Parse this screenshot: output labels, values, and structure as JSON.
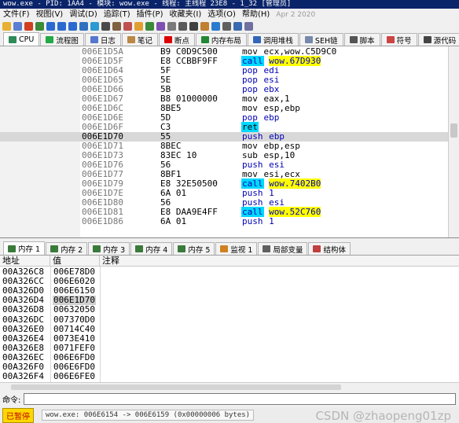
{
  "title": "wow.exe - PID: 1AA4 - 模块: wow.exe - 线程: 主线程 23E8 - 1_32 [管理员]",
  "menu": [
    "文件(F)",
    "视图(V)",
    "调试(D)",
    "追踪(T)",
    "插件(P)",
    "收藏夹(I)",
    "选项(O)",
    "帮助(H)"
  ],
  "menu_date": "Apr 2 2020",
  "tabs": [
    {
      "label": "CPU",
      "icon": "cpu-icon",
      "color": "#2e8b57"
    },
    {
      "label": "流程图",
      "icon": "graph-icon",
      "color": "#22aa44"
    },
    {
      "label": "日志",
      "icon": "log-icon",
      "color": "#5577cc"
    },
    {
      "label": "笔记",
      "icon": "notes-icon",
      "color": "#bb8844"
    },
    {
      "label": "断点",
      "icon": "breakpoint-icon",
      "color": "#dd0000"
    },
    {
      "label": "内存布局",
      "icon": "memory-map-icon",
      "color": "#228833"
    },
    {
      "label": "调用堆栈",
      "icon": "call-stack-icon",
      "color": "#3366bb"
    },
    {
      "label": "SEH链",
      "icon": "seh-icon",
      "color": "#7788aa"
    },
    {
      "label": "脚本",
      "icon": "script-icon",
      "color": "#555555"
    },
    {
      "label": "符号",
      "icon": "symbols-icon",
      "color": "#cc4444"
    },
    {
      "label": "源代码",
      "icon": "source-icon",
      "color": "#444444"
    }
  ],
  "disasm": [
    {
      "addr": "006E1D5A",
      "bytes": "B9 C0D9C500",
      "mn": "mov",
      "mnc": "plain",
      "op": "ecx,wow.C5D9C0",
      "opc": ""
    },
    {
      "addr": "006E1D5F",
      "bytes": "E8 CCBBF9FF",
      "mn": "call",
      "mnc": "call",
      "op": "wow.67D930",
      "opc": "tgt"
    },
    {
      "addr": "006E1D64",
      "bytes": "5F",
      "mn": "pop",
      "mnc": "pop",
      "op": "edi",
      "opc": "num"
    },
    {
      "addr": "006E1D65",
      "bytes": "5E",
      "mn": "pop",
      "mnc": "pop",
      "op": "esi",
      "opc": "num"
    },
    {
      "addr": "006E1D66",
      "bytes": "5B",
      "mn": "pop",
      "mnc": "pop",
      "op": "ebx",
      "opc": "num"
    },
    {
      "addr": "006E1D67",
      "bytes": "B8 01000000",
      "mn": "mov",
      "mnc": "plain",
      "op": "eax,1",
      "opc": ""
    },
    {
      "addr": "006E1D6C",
      "bytes": "8BE5",
      "mn": "mov",
      "mnc": "plain",
      "op": "esp,ebp",
      "opc": ""
    },
    {
      "addr": "006E1D6E",
      "bytes": "5D",
      "mn": "pop",
      "mnc": "pop",
      "op": "ebp",
      "opc": "num"
    },
    {
      "addr": "006E1D6F",
      "bytes": "C3",
      "mn": "ret",
      "mnc": "ret",
      "op": "",
      "opc": ""
    },
    {
      "addr": "006E1D70",
      "bytes": "55",
      "mn": "push",
      "mnc": "push",
      "op": "ebp",
      "opc": "num",
      "sel": true
    },
    {
      "addr": "006E1D71",
      "bytes": "8BEC",
      "mn": "mov",
      "mnc": "plain",
      "op": "ebp,esp",
      "opc": ""
    },
    {
      "addr": "006E1D73",
      "bytes": "83EC 10",
      "mn": "sub",
      "mnc": "plain",
      "op": "esp,10",
      "opc": ""
    },
    {
      "addr": "006E1D76",
      "bytes": "56",
      "mn": "push",
      "mnc": "push",
      "op": "esi",
      "opc": "num"
    },
    {
      "addr": "006E1D77",
      "bytes": "8BF1",
      "mn": "mov",
      "mnc": "plain",
      "op": "esi,ecx",
      "opc": ""
    },
    {
      "addr": "006E1D79",
      "bytes": "E8 32E50500",
      "mn": "call",
      "mnc": "call",
      "op": "wow.7402B0",
      "opc": "tgt"
    },
    {
      "addr": "006E1D7E",
      "bytes": "6A 01",
      "mn": "push",
      "mnc": "push",
      "op": "1",
      "opc": "num"
    },
    {
      "addr": "006E1D80",
      "bytes": "56",
      "mn": "push",
      "mnc": "push",
      "op": "esi",
      "opc": "num"
    },
    {
      "addr": "006E1D81",
      "bytes": "E8 DAA9E4FF",
      "mn": "call",
      "mnc": "call",
      "op": "wow.52C760",
      "opc": "tgt"
    },
    {
      "addr": "006E1D86",
      "bytes": "6A 01",
      "mn": "push",
      "mnc": "push",
      "op": "1",
      "opc": "num"
    }
  ],
  "mem_tabs": [
    {
      "label": "内存 1",
      "icon": "memory-icon"
    },
    {
      "label": "内存 2",
      "icon": "memory-icon"
    },
    {
      "label": "内存 3",
      "icon": "memory-icon"
    },
    {
      "label": "内存 4",
      "icon": "memory-icon"
    },
    {
      "label": "内存 5",
      "icon": "memory-icon"
    },
    {
      "label": "监视 1",
      "icon": "watch-icon"
    },
    {
      "label": "局部变量",
      "icon": "locals-icon"
    },
    {
      "label": "结构体",
      "icon": "struct-icon"
    }
  ],
  "mem_header": {
    "addr": "地址",
    "value": "值",
    "comment": "注释"
  },
  "mem_rows": [
    {
      "a": "00A326C8",
      "v": "006E78D0"
    },
    {
      "a": "00A326CC",
      "v": "006E6020"
    },
    {
      "a": "00A326D0",
      "v": "006E6150"
    },
    {
      "a": "00A326D4",
      "v": "006E1D70",
      "hl": true
    },
    {
      "a": "00A326D8",
      "v": "00632050"
    },
    {
      "a": "00A326DC",
      "v": "007370D0"
    },
    {
      "a": "00A326E0",
      "v": "00714C40"
    },
    {
      "a": "00A326E4",
      "v": "0073E410"
    },
    {
      "a": "00A326E8",
      "v": "0071FEF0"
    },
    {
      "a": "00A326EC",
      "v": "006E6FD0"
    },
    {
      "a": "00A326F0",
      "v": "006E6FD0"
    },
    {
      "a": "00A326F4",
      "v": "006E6FE0"
    }
  ],
  "cmd_label": "命令:",
  "status_badge": "已暂停",
  "status_msg": "wow.exe: 006E6154 -> 006E6159 (0x00000006 bytes)",
  "watermark": "CSDN @zhaopeng01zp"
}
